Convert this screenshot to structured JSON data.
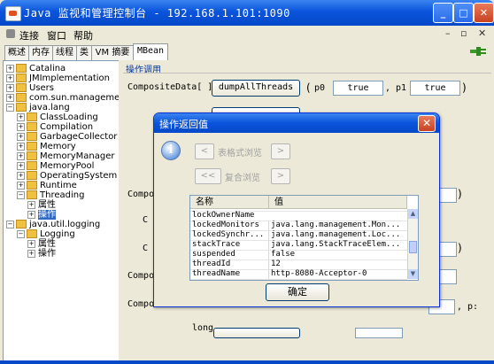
{
  "window": {
    "title": "Java 监视和管理控制台 - 192.168.1.101:1090"
  },
  "menu": {
    "items": [
      "连接",
      "窗口",
      "帮助"
    ]
  },
  "tabs": [
    "概述",
    "内存",
    "线程",
    "类",
    "VM 摘要",
    "MBean"
  ],
  "tree": [
    {
      "label": "Catalina",
      "level": 0,
      "type": "folder"
    },
    {
      "label": "JMImplementation",
      "level": 0,
      "type": "folder"
    },
    {
      "label": "Users",
      "level": 0,
      "type": "folder"
    },
    {
      "label": "com.sun.management",
      "level": 0,
      "type": "folder"
    },
    {
      "label": "java.lang",
      "level": 0,
      "type": "folder",
      "expanded": true
    },
    {
      "label": "ClassLoading",
      "level": 1,
      "type": "folder"
    },
    {
      "label": "Compilation",
      "level": 1,
      "type": "folder"
    },
    {
      "label": "GarbageCollector",
      "level": 1,
      "type": "folder"
    },
    {
      "label": "Memory",
      "level": 1,
      "type": "folder"
    },
    {
      "label": "MemoryManager",
      "level": 1,
      "type": "folder"
    },
    {
      "label": "MemoryPool",
      "level": 1,
      "type": "folder"
    },
    {
      "label": "OperatingSystem",
      "level": 1,
      "type": "folder"
    },
    {
      "label": "Runtime",
      "level": 1,
      "type": "folder"
    },
    {
      "label": "Threading",
      "level": 1,
      "type": "folder",
      "expanded": true
    },
    {
      "label": "属性",
      "level": 2,
      "type": "leaf"
    },
    {
      "label": "操作",
      "level": 2,
      "type": "leaf",
      "selected": true
    },
    {
      "label": "java.util.logging",
      "level": 0,
      "type": "folder",
      "expanded": true
    },
    {
      "label": "Logging",
      "level": 1,
      "type": "folder",
      "expanded": true
    },
    {
      "label": "属性",
      "level": 2,
      "type": "leaf"
    },
    {
      "label": "操作",
      "level": 2,
      "type": "leaf"
    }
  ],
  "operations": {
    "header": "操作调用",
    "row1": {
      "return_type": "CompositeData[ ]",
      "button": "dumpAllThreads",
      "open_paren": "(",
      "p0_label": "p0",
      "p0_value": "true",
      "p1_label": ", p1",
      "p1_value": "true",
      "close_paren": ")"
    },
    "partial_labels": [
      "Compo",
      "C",
      "C",
      "Compo",
      "Composi"
    ],
    "row_long": "long",
    "p_fragment": ", p:"
  },
  "dialog": {
    "title": "操作返回值",
    "table_view": "表格式浏览",
    "composite_view": "复合浏览",
    "nav_prev": "<",
    "nav_next": ">",
    "nav_first": "<<",
    "columns": [
      "名称",
      "值"
    ],
    "rows": [
      {
        "name": "lockOwnerName",
        "value": ""
      },
      {
        "name": "lockedMonitors",
        "value": "java.lang.management.Mon..."
      },
      {
        "name": "lockedSynchr...",
        "value": "java.lang.management.Loc..."
      },
      {
        "name": "stackTrace",
        "value": "java.lang.StackTraceElem..."
      },
      {
        "name": "suspended",
        "value": "false"
      },
      {
        "name": "threadId",
        "value": "12"
      },
      {
        "name": "threadName",
        "value": "http-8080-Acceptor-0"
      }
    ],
    "ok": "确定"
  }
}
